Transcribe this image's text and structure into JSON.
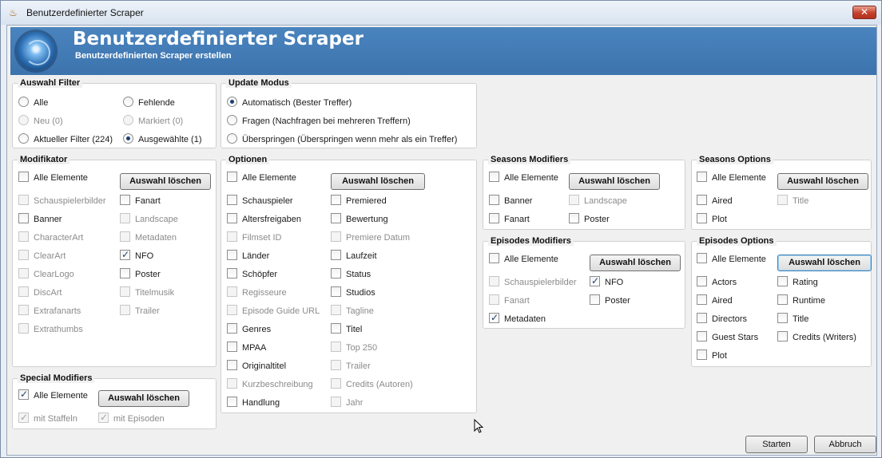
{
  "window": {
    "title": "Benutzerdefinierter Scraper",
    "close": "✕"
  },
  "header": {
    "title": "Benutzerdefinierter Scraper",
    "subtitle": "Benutzerdefinierten Scraper erstellen"
  },
  "filter": {
    "legend": "Auswahl Filter",
    "all": "Alle",
    "missing": "Fehlende",
    "new": "Neu (0)",
    "marked": "Markiert (0)",
    "current": "Aktueller Filter (224)",
    "selected": "Ausgewählte (1)"
  },
  "update": {
    "legend": "Update Modus",
    "auto": "Automatisch (Bester Treffer)",
    "ask": "Fragen (Nachfragen bei mehreren Treffern)",
    "skip": "Überspringen (Überspringen wenn mehr als ein Treffer)"
  },
  "common": {
    "all_items": "Alle Elemente",
    "clear": "Auswahl löschen"
  },
  "modifiers": {
    "legend": "Modifikator",
    "left": [
      "Schauspielerbilder",
      "Banner",
      "CharacterArt",
      "ClearArt",
      "ClearLogo",
      "DiscArt",
      "Extrafanarts",
      "Extrathumbs"
    ],
    "right": [
      "Fanart",
      "Landscape",
      "Metadaten",
      "NFO",
      "Poster",
      "Titelmusik",
      "Trailer"
    ]
  },
  "special": {
    "legend": "Special Modifiers",
    "staffeln": "mit Staffeln",
    "episoden": "mit Episoden"
  },
  "options": {
    "legend": "Optionen",
    "left": [
      "Schauspieler",
      "Altersfreigaben",
      "Filmset ID",
      "Länder",
      "Schöpfer",
      "Regisseure",
      "Episode Guide URL",
      "Genres",
      "MPAA",
      "Originaltitel",
      "Kurzbeschreibung",
      "Handlung"
    ],
    "right": [
      "Premiered",
      "Bewertung",
      "Premiere Datum",
      "Laufzeit",
      "Status",
      "Studios",
      "Tagline",
      "Titel",
      "Top 250",
      "Trailer",
      "Credits (Autoren)",
      "Jahr"
    ]
  },
  "seasons_mod": {
    "legend": "Seasons Modifiers",
    "banner": "Banner",
    "fanart": "Fanart",
    "landscape": "Landscape",
    "poster": "Poster"
  },
  "seasons_opt": {
    "legend": "Seasons Options",
    "aired": "Aired",
    "plot": "Plot",
    "title": "Title"
  },
  "episodes_mod": {
    "legend": "Episodes Modifiers",
    "actorthumbs": "Schauspielerbilder",
    "fanart": "Fanart",
    "meta": "Metadaten",
    "nfo": "NFO",
    "poster": "Poster"
  },
  "episodes_opt": {
    "legend": "Episodes Options",
    "left": [
      "Actors",
      "Aired",
      "Directors",
      "Guest Stars",
      "Plot"
    ],
    "right": [
      "Rating",
      "Runtime",
      "Title",
      "Credits (Writers)"
    ]
  },
  "footer": {
    "start": "Starten",
    "cancel": "Abbruch"
  }
}
